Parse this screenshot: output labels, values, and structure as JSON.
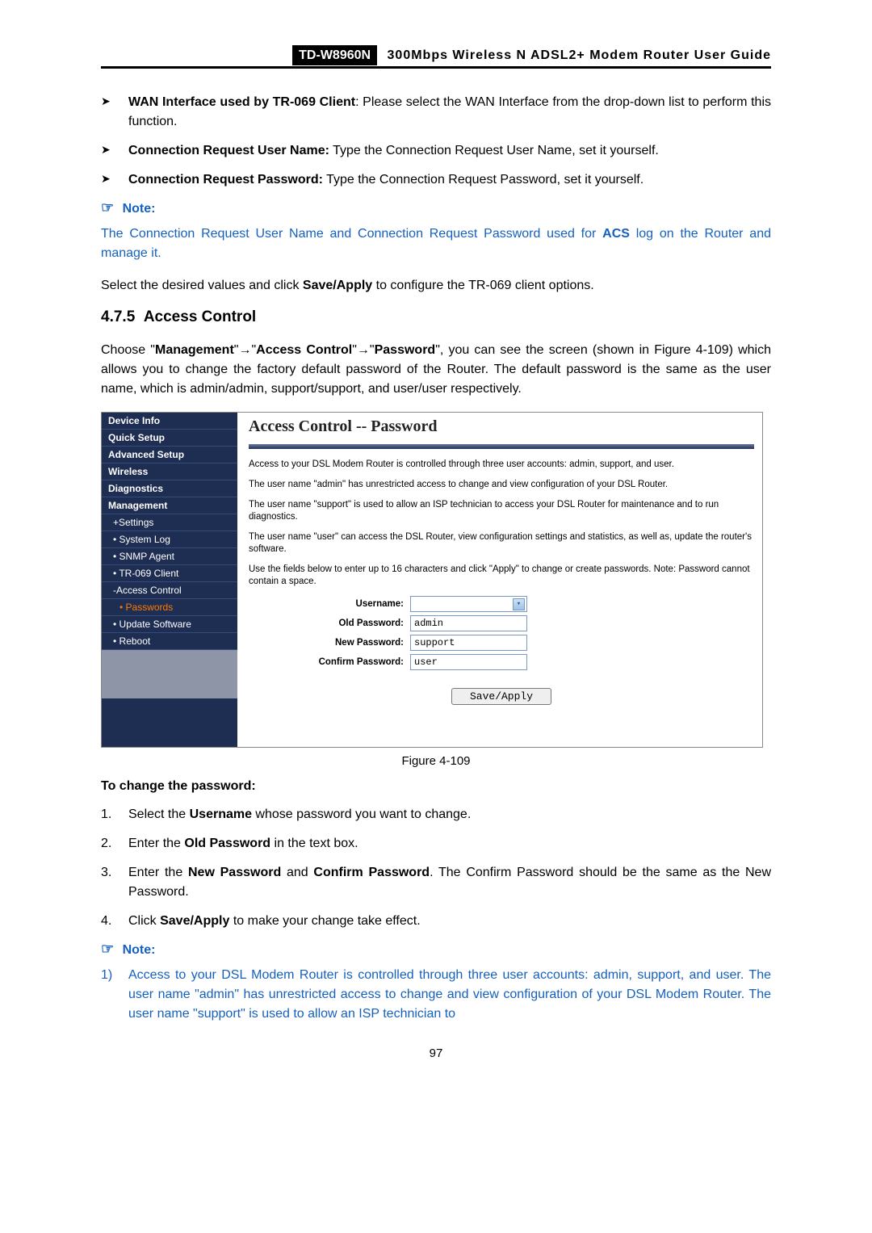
{
  "header": {
    "model": "TD-W8960N",
    "title": "300Mbps Wireless N ADSL2+ Modem Router User Guide"
  },
  "bullets": [
    {
      "label": "WAN Interface used by TR-069 Client",
      "sep": ": ",
      "text": "Please select the WAN Interface from the drop-down list to perform this function."
    },
    {
      "label": "Connection Request User Name:",
      "sep": " ",
      "text": "Type the Connection Request User Name, set it yourself."
    },
    {
      "label": "Connection Request Password:",
      "sep": " ",
      "text": "Type the Connection Request Password, set it yourself."
    }
  ],
  "note1": {
    "label": "Note:",
    "body_pre": "The Connection Request User Name and Connection Request Password used for ",
    "body_bold": "ACS",
    "body_post": " log on the Router and manage it."
  },
  "select_para": {
    "pre": "Select the desired values and click ",
    "bold": "Save/Apply",
    "post": " to configure the TR-069 client options."
  },
  "section": {
    "num": "4.7.5",
    "title": "Access Control"
  },
  "choose_para": {
    "t1": "Choose \"",
    "b1": "Management",
    "arrow": "→",
    "q": "\"",
    "b2": "Access Control",
    "b3": "Password",
    "t2": "\", you can see the screen (shown in Figure 4-109) which allows you to change the factory default password of the Router. The default password is the same as the user name, which is admin/admin, support/support, and user/user respectively."
  },
  "figure": {
    "sidebar": [
      {
        "label": "Device Info",
        "cls": "sb-item"
      },
      {
        "label": "Quick Setup",
        "cls": "sb-item"
      },
      {
        "label": "Advanced Setup",
        "cls": "sb-item"
      },
      {
        "label": "Wireless",
        "cls": "sb-item"
      },
      {
        "label": "Diagnostics",
        "cls": "sb-item"
      },
      {
        "label": "Management",
        "cls": "sb-item"
      },
      {
        "label": "+Settings",
        "cls": "sb-item sb-sub"
      },
      {
        "label": "• System Log",
        "cls": "sb-item sb-sub"
      },
      {
        "label": "• SNMP Agent",
        "cls": "sb-item sb-sub"
      },
      {
        "label": "• TR-069 Client",
        "cls": "sb-item sb-sub"
      },
      {
        "label": "-Access Control",
        "cls": "sb-item sb-sub"
      },
      {
        "label": "• Passwords",
        "cls": "sb-item sb-sub2 sb-active"
      },
      {
        "label": "• Update Software",
        "cls": "sb-item sb-sub"
      },
      {
        "label": "• Reboot",
        "cls": "sb-item sb-sub"
      }
    ],
    "main": {
      "title": "Access Control -- Password",
      "p1": "Access to your DSL Modem Router is controlled through three user accounts: admin, support, and user.",
      "p2": "The user name \"admin\" has unrestricted access to change and view configuration of your DSL Router.",
      "p3": "The user name \"support\" is used to allow an ISP technician to access your DSL Router for maintenance and to run diagnostics.",
      "p4": "The user name \"user\" can access the DSL Router, view configuration settings and statistics, as well as, update the router's software.",
      "p5": "Use the fields below to enter up to 16 characters and click \"Apply\" to change or create passwords. Note: Password cannot contain a space.",
      "labels": {
        "username": "Username:",
        "oldpw": "Old Password:",
        "newpw": "New Password:",
        "confirmpw": "Confirm Password:"
      },
      "options": [
        "admin",
        "support",
        "user"
      ],
      "apply": "Save/Apply"
    },
    "caption": "Figure 4-109"
  },
  "change_heading": "To change the password:",
  "steps": [
    {
      "n": "1.",
      "parts": [
        {
          "t": "Select the "
        },
        {
          "b": "Username"
        },
        {
          "t": " whose password you want to change."
        }
      ]
    },
    {
      "n": "2.",
      "parts": [
        {
          "t": "Enter the "
        },
        {
          "b": "Old Password"
        },
        {
          "t": " in the text box."
        }
      ]
    },
    {
      "n": "3.",
      "parts": [
        {
          "t": "Enter the "
        },
        {
          "b": "New Password"
        },
        {
          "t": " and "
        },
        {
          "b": "Confirm Password"
        },
        {
          "t": ". The Confirm Password should be the same as the New Password."
        }
      ]
    },
    {
      "n": "4.",
      "parts": [
        {
          "t": "Click "
        },
        {
          "b": "Save/Apply"
        },
        {
          "t": " to make your change take effect."
        }
      ]
    }
  ],
  "note2": {
    "label": "Note:",
    "item_n": "1)",
    "body": "Access to your DSL Modem Router is controlled through three user accounts: admin, support, and user. The user name \"admin\" has unrestricted access to change and view configuration of your DSL Modem Router. The user name \"support\" is used to allow an ISP technician to"
  },
  "page_number": "97"
}
